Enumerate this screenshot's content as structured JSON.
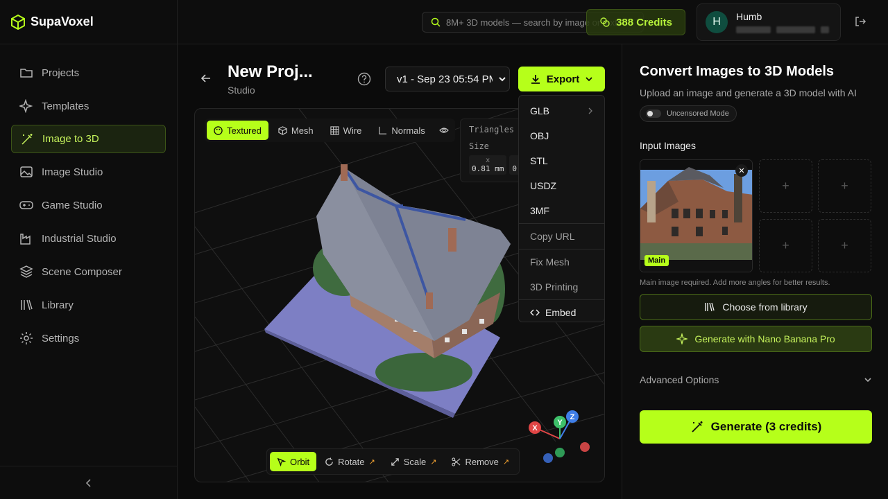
{
  "app": {
    "name": "SupaVoxel",
    "accent": "#b6ff1a"
  },
  "sidebar": {
    "items": [
      {
        "label": "Projects",
        "icon": "folder-icon"
      },
      {
        "label": "Templates",
        "icon": "sparkles-icon"
      },
      {
        "label": "Image to 3D",
        "icon": "wand-icon",
        "active": true
      },
      {
        "label": "Image Studio",
        "icon": "image-icon"
      },
      {
        "label": "Game Studio",
        "icon": "gamepad-icon"
      },
      {
        "label": "Industrial Studio",
        "icon": "factory-icon"
      },
      {
        "label": "Scene Composer",
        "icon": "layers-icon"
      },
      {
        "label": "Library",
        "icon": "library-icon"
      },
      {
        "label": "Settings",
        "icon": "gear-icon"
      }
    ],
    "collapse_icon": "chevron-left-icon"
  },
  "topbar": {
    "search_placeholder": "8M+ 3D models — search by image or text",
    "credits": "388 Credits",
    "user": {
      "initial": "H",
      "name": "Humb"
    }
  },
  "project": {
    "title": "New Proj...",
    "subtitle": "Studio",
    "version": "v1 - Sep 23 05:54 PM",
    "export_label": "Export"
  },
  "viewport": {
    "tabs": [
      {
        "label": "Textured",
        "icon": "palette-icon",
        "active": true
      },
      {
        "label": "Mesh",
        "icon": "cube-icon"
      },
      {
        "label": "Wire",
        "icon": "grid-icon"
      },
      {
        "label": "Normals",
        "icon": "axis-icon"
      }
    ],
    "stats": {
      "triangles_label": "Triangles",
      "size_label": "Size",
      "x_label": "x",
      "x_value": "0.81 mm",
      "y_value": "0"
    },
    "tools": [
      {
        "label": "Orbit",
        "icon": "cursor-icon",
        "active": true
      },
      {
        "label": "Rotate",
        "icon": "rotate-icon"
      },
      {
        "label": "Scale",
        "icon": "scale-icon"
      },
      {
        "label": "Remove",
        "icon": "scissors-icon"
      }
    ],
    "gizmo": {
      "x": "X",
      "y": "Y",
      "z": "Z"
    }
  },
  "export_menu": {
    "formats": [
      "GLB",
      "OBJ",
      "STL",
      "USDZ",
      "3MF"
    ],
    "copy_url": "Copy URL",
    "fix_mesh": "Fix Mesh",
    "printing": "3D Printing",
    "embed": "Embed"
  },
  "panel": {
    "title": "Convert Images to 3D Models",
    "subtitle": "Upload an image and generate a 3D model with AI",
    "uncensored": "Uncensored Mode",
    "input_label": "Input Images",
    "main_badge": "Main",
    "hint": "Main image required. Add more angles for better results.",
    "library_btn": "Choose from library",
    "nano_btn": "Generate with Nano Banana Pro",
    "advanced": "Advanced Options",
    "generate_btn": "Generate (3 credits)"
  }
}
